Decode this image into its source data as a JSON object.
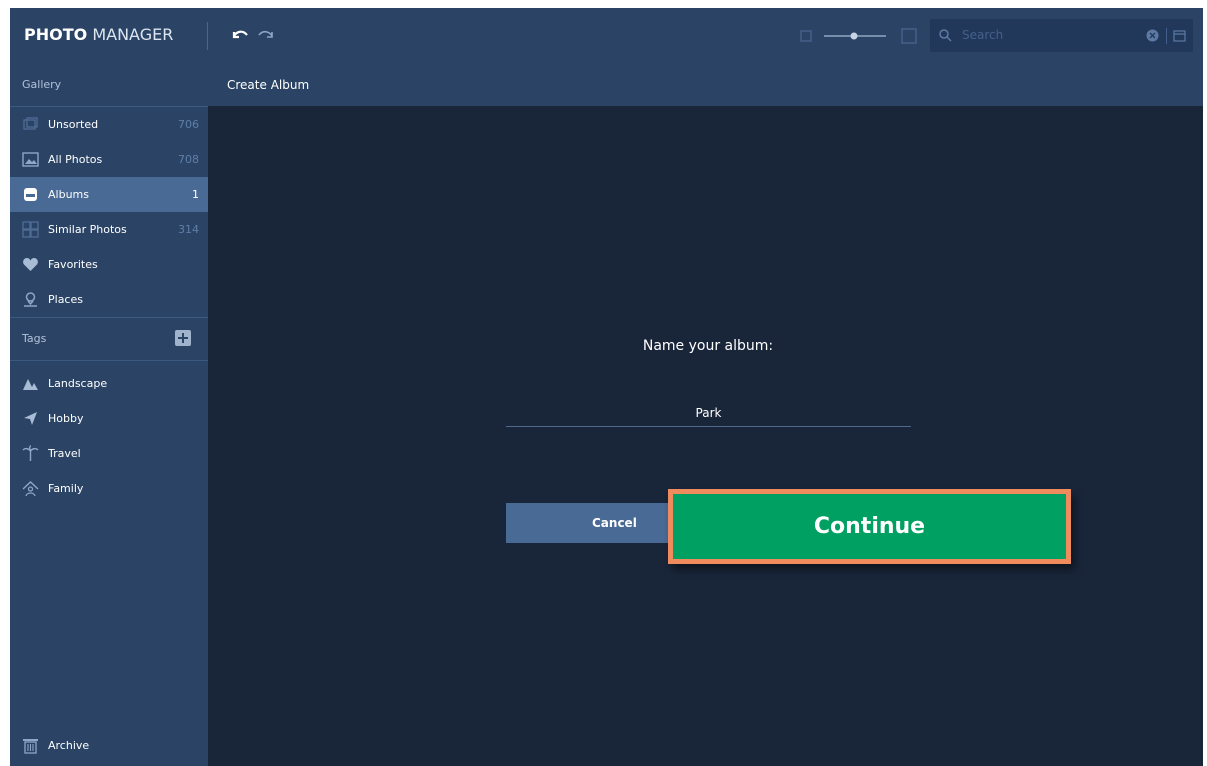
{
  "app": {
    "title_bold": "PHOTO",
    "title_rest": " MANAGER"
  },
  "search": {
    "placeholder": "Search"
  },
  "sidebar": {
    "gallery_heading": "Gallery",
    "gallery_items": [
      {
        "label": "Unsorted",
        "count": "706",
        "icon": "unsorted-icon"
      },
      {
        "label": "All Photos",
        "count": "708",
        "icon": "photos-icon"
      },
      {
        "label": "Albums",
        "count": "1",
        "icon": "albums-icon",
        "active": true
      },
      {
        "label": "Similar Photos",
        "count": "314",
        "icon": "similar-photos-icon"
      },
      {
        "label": "Favorites",
        "count": "",
        "icon": "heart-icon"
      },
      {
        "label": "Places",
        "count": "",
        "icon": "map-pin-icon"
      }
    ],
    "tags_heading": "Tags",
    "tag_items": [
      {
        "label": "Landscape",
        "icon": "landscape-icon"
      },
      {
        "label": "Hobby",
        "icon": "hobby-icon"
      },
      {
        "label": "Travel",
        "icon": "palm-tree-icon"
      },
      {
        "label": "Family",
        "icon": "family-icon"
      }
    ],
    "archive_label": "Archive"
  },
  "main": {
    "header": "Create Album",
    "prompt": "Name your album:",
    "album_name_value": "Park",
    "cancel_label": "Cancel",
    "continue_label": "Continue"
  },
  "colors": {
    "topbar": "#2b4466",
    "background": "#19263a",
    "active_item": "#4a6a96",
    "continue_button": "#00a062",
    "highlight_border": "#ef8b5c"
  }
}
